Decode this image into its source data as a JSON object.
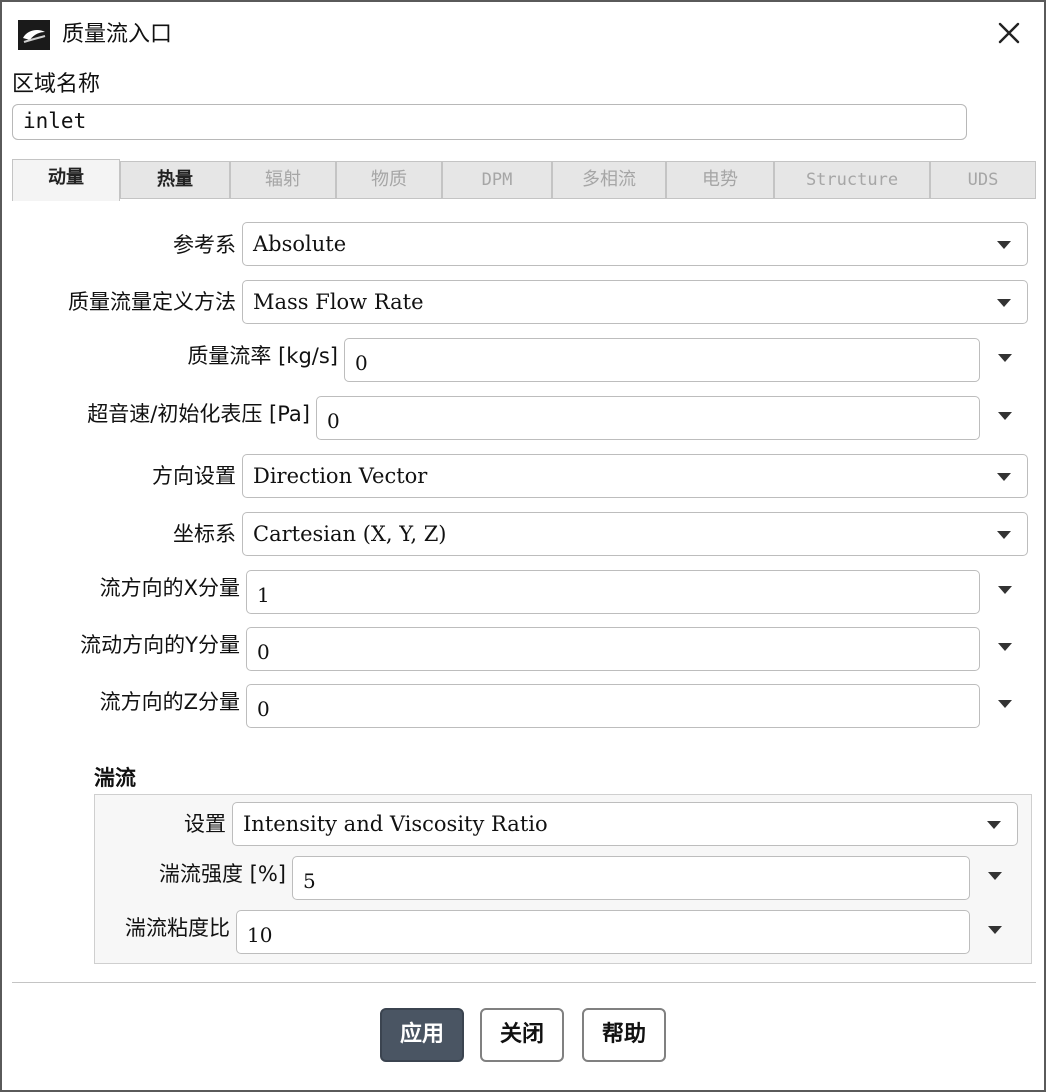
{
  "window": {
    "title": "质量流入口"
  },
  "zone": {
    "label": "区域名称",
    "value": "inlet"
  },
  "tabs": [
    {
      "label": "动量",
      "state": "active"
    },
    {
      "label": "热量",
      "state": "enabled"
    },
    {
      "label": "辐射",
      "state": "disabled"
    },
    {
      "label": "物质",
      "state": "disabled"
    },
    {
      "label": "DPM",
      "state": "disabled"
    },
    {
      "label": "多相流",
      "state": "disabled"
    },
    {
      "label": "电势",
      "state": "disabled"
    },
    {
      "label": "Structure",
      "state": "disabled"
    },
    {
      "label": "UDS",
      "state": "disabled"
    }
  ],
  "momentum": {
    "reference_frame": {
      "label": "参考系",
      "value": "Absolute"
    },
    "mass_flow_spec": {
      "label": "质量流量定义方法",
      "value": "Mass Flow Rate"
    },
    "mass_flow_rate": {
      "label": "质量流率 [kg/s]",
      "value": "0"
    },
    "supersonic_pressure": {
      "label": "超音速/初始化表压 [Pa]",
      "value": "0"
    },
    "direction_spec": {
      "label": "方向设置",
      "value": "Direction Vector"
    },
    "coordinate_system": {
      "label": "坐标系",
      "value": "Cartesian (X, Y, Z)"
    },
    "x_component": {
      "label": "流方向的X分量",
      "value": "1"
    },
    "y_component": {
      "label": "流动方向的Y分量",
      "value": "0"
    },
    "z_component": {
      "label": "流方向的Z分量",
      "value": "0"
    }
  },
  "turbulence": {
    "title": "湍流",
    "specification": {
      "label": "设置",
      "value": "Intensity and Viscosity Ratio"
    },
    "intensity": {
      "label": "湍流强度 [%]",
      "value": "5"
    },
    "viscosity_ratio": {
      "label": "湍流粘度比",
      "value": "10"
    }
  },
  "buttons": {
    "apply": "应用",
    "close": "关闭",
    "help": "帮助"
  },
  "colors": {
    "primary_button": "#4a5563",
    "tab_bg": "#e6e6e6",
    "border": "#bdbdbd"
  }
}
